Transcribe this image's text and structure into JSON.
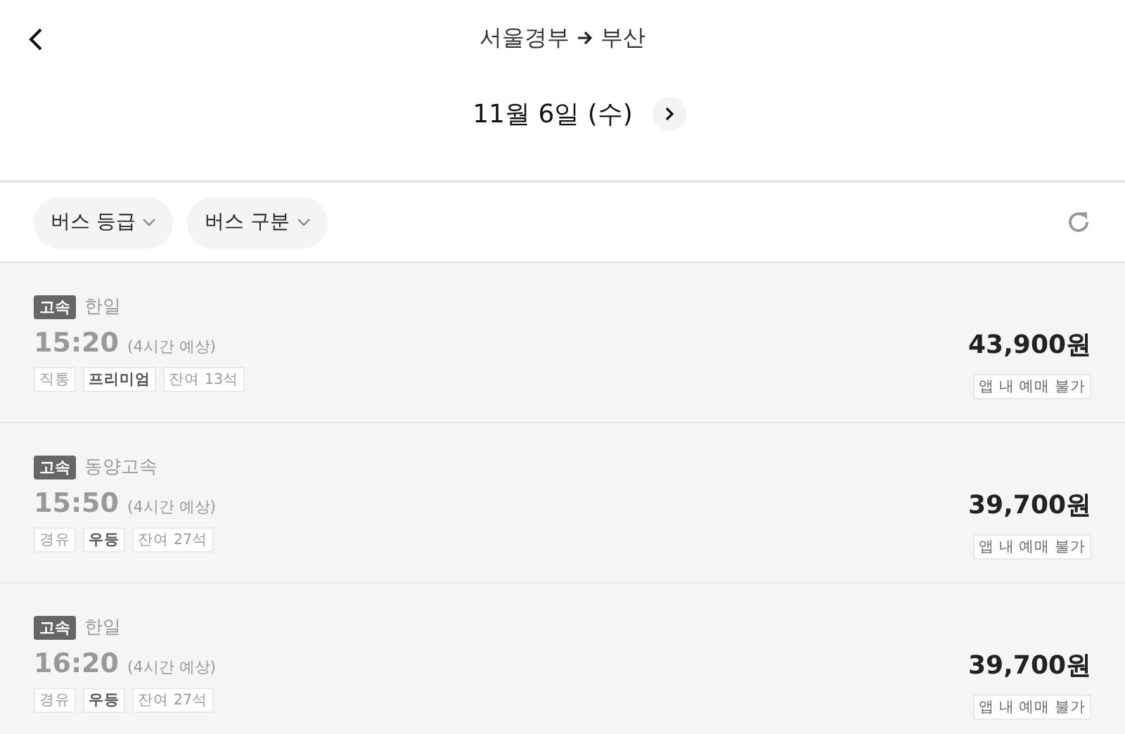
{
  "header": {
    "route_from": "서울경부",
    "route_to": "부산",
    "date": "11월 6일 (수)"
  },
  "filters": [
    {
      "label": "버스 등급"
    },
    {
      "label": "버스 구분"
    }
  ],
  "trips": [
    {
      "grade": "고속",
      "company": "한일",
      "time": "15:20",
      "duration": "(4시간 예상)",
      "disabled": true,
      "tags": [
        {
          "label": "직통",
          "strong": false
        },
        {
          "label": "프리미엄",
          "strong": true
        },
        {
          "label": "잔여 13석",
          "strong": false
        }
      ],
      "price": "43,900원",
      "note": "앱 내 예매 불가"
    },
    {
      "grade": "고속",
      "company": "동양고속",
      "time": "15:50",
      "duration": "(4시간 예상)",
      "disabled": true,
      "tags": [
        {
          "label": "경유",
          "strong": false
        },
        {
          "label": "우등",
          "strong": true
        },
        {
          "label": "잔여 27석",
          "strong": false
        }
      ],
      "price": "39,700원",
      "note": "앱 내 예매 불가"
    },
    {
      "grade": "고속",
      "company": "한일",
      "time": "16:20",
      "duration": "(4시간 예상)",
      "disabled": true,
      "tags": [
        {
          "label": "경유",
          "strong": false
        },
        {
          "label": "우등",
          "strong": true
        },
        {
          "label": "잔여 27석",
          "strong": false
        }
      ],
      "price": "39,700원",
      "note": "앱 내 예매 불가"
    }
  ]
}
